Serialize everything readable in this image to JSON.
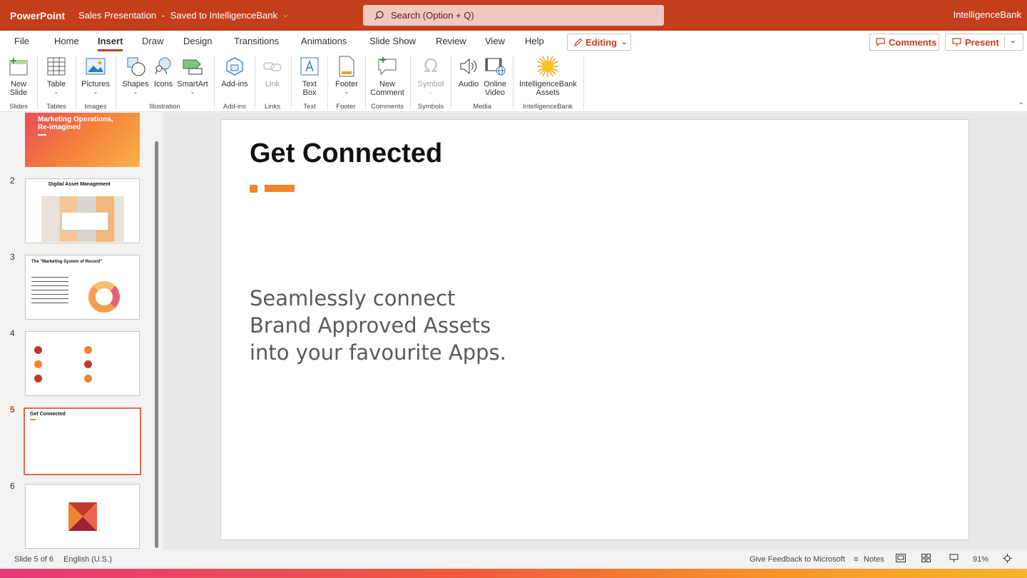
{
  "titlebar": {
    "app_name": "PowerPoint",
    "doc_title": "Sales Presentation",
    "doc_status": "Saved to IntelligenceBank",
    "search_placeholder": "Search (Option + Q)",
    "tenant": "IntelligenceBank"
  },
  "tabs": [
    "File",
    "Home",
    "Insert",
    "Draw",
    "Design",
    "Transitions",
    "Animations",
    "Slide Show",
    "Review",
    "View",
    "Help"
  ],
  "active_tab": "Insert",
  "mode_button": "Editing",
  "comments_button": "Comments",
  "present_button": "Present",
  "ribbon": {
    "new_slide": "New Slide",
    "table": "Table",
    "pictures": "Pictures",
    "shapes": "Shapes",
    "icons": "Icons",
    "smartart": "SmartArt",
    "addins": "Add-ins",
    "link": "Link",
    "textbox": "Text Box",
    "footer": "Footer",
    "new_comment": "New Comment",
    "symbol": "Symbol",
    "audio": "Audio",
    "online_video": "Online Video",
    "ib_assets": "IntelligenceBank Assets",
    "groups": {
      "slides": "Slides",
      "tables": "Tables",
      "images": "Images",
      "illustration": "Illustration",
      "addins": "Add-ins",
      "links": "Links",
      "text": "Text",
      "footer": "Footer",
      "comments": "Comments",
      "symbols": "Symbols",
      "media": "Media",
      "ib": "IntelligenceBank"
    }
  },
  "thumbnails": [
    {
      "num": "",
      "title": "Marketing Operations, Re-imagined"
    },
    {
      "num": "2",
      "title": "Digital Asset Management"
    },
    {
      "num": "3",
      "title": "The \"Marketing System of Record\""
    },
    {
      "num": "4",
      "title": ""
    },
    {
      "num": "5",
      "title": "Get Connected"
    },
    {
      "num": "6",
      "title": ""
    }
  ],
  "slide": {
    "title": "Get Connected",
    "body": [
      "Seamlessly connect",
      "Brand Approved Assets",
      "into your favourite Apps."
    ]
  },
  "status": {
    "slide_counter": "Slide 5 of 6",
    "language": "English (U.S.)",
    "feedback": "Give Feedback to Microsoft",
    "notes": "Notes",
    "zoom": "91%"
  },
  "colors": {
    "brand": "#c43e1c",
    "accent": "#f0842d"
  }
}
